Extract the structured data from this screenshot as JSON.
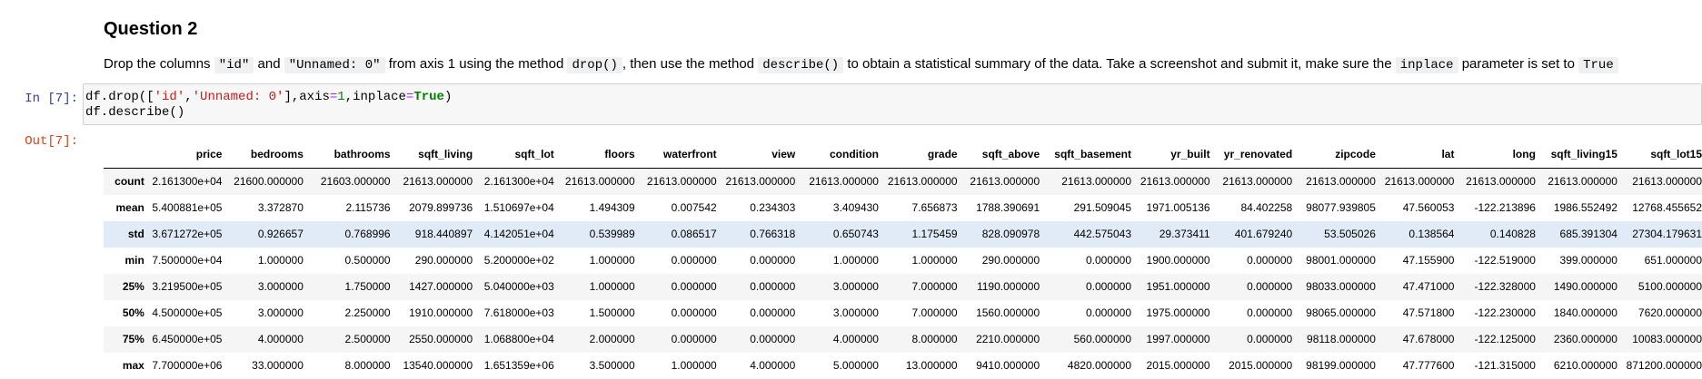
{
  "markdown": {
    "heading": "Question 2",
    "text_1": "Drop the columns ",
    "code_1": "\"id\"",
    "text_2": " and ",
    "code_2": "\"Unnamed: 0\"",
    "text_3": " from axis 1 using the method ",
    "code_3": "drop()",
    "text_4": ", then use the method ",
    "code_4": "describe()",
    "text_5": " to obtain a statistical summary of the data. Take a screenshot and submit it, make sure the ",
    "code_5": "inplace",
    "text_6": " parameter is set to ",
    "code_6": "True"
  },
  "cell": {
    "in_prompt": "In [7]:",
    "out_prompt": "Out[7]:",
    "code": {
      "l1_a": "df.drop([",
      "l1_s1": "'id'",
      "l1_b": ",",
      "l1_s2": "'Unnamed: 0'",
      "l1_c": "],axis",
      "l1_eq1": "=",
      "l1_n": "1",
      "l1_d": ",inplace",
      "l1_eq2": "=",
      "l1_kw": "True",
      "l1_e": ")",
      "l2": "df.describe()"
    }
  },
  "table": {
    "columns": [
      "price",
      "bedrooms",
      "bathrooms",
      "sqft_living",
      "sqft_lot",
      "floors",
      "waterfront",
      "view",
      "condition",
      "grade",
      "sqft_above",
      "sqft_basement",
      "yr_built",
      "yr_renovated",
      "zipcode",
      "lat",
      "long",
      "sqft_living15",
      "sqft_lot15"
    ],
    "rows": [
      {
        "label": "count",
        "values": [
          "2.161300e+04",
          "21600.000000",
          "21603.000000",
          "21613.000000",
          "2.161300e+04",
          "21613.000000",
          "21613.000000",
          "21613.000000",
          "21613.000000",
          "21613.000000",
          "21613.000000",
          "21613.000000",
          "21613.000000",
          "21613.000000",
          "21613.000000",
          "21613.000000",
          "21613.000000",
          "21613.000000",
          "21613.000000"
        ]
      },
      {
        "label": "mean",
        "values": [
          "5.400881e+05",
          "3.372870",
          "2.115736",
          "2079.899736",
          "1.510697e+04",
          "1.494309",
          "0.007542",
          "0.234303",
          "3.409430",
          "7.656873",
          "1788.390691",
          "291.509045",
          "1971.005136",
          "84.402258",
          "98077.939805",
          "47.560053",
          "-122.213896",
          "1986.552492",
          "12768.455652"
        ]
      },
      {
        "label": "std",
        "values": [
          "3.671272e+05",
          "0.926657",
          "0.768996",
          "918.440897",
          "4.142051e+04",
          "0.539989",
          "0.086517",
          "0.766318",
          "0.650743",
          "1.175459",
          "828.090978",
          "442.575043",
          "29.373411",
          "401.679240",
          "53.505026",
          "0.138564",
          "0.140828",
          "685.391304",
          "27304.179631"
        ]
      },
      {
        "label": "min",
        "values": [
          "7.500000e+04",
          "1.000000",
          "0.500000",
          "290.000000",
          "5.200000e+02",
          "1.000000",
          "0.000000",
          "0.000000",
          "1.000000",
          "1.000000",
          "290.000000",
          "0.000000",
          "1900.000000",
          "0.000000",
          "98001.000000",
          "47.155900",
          "-122.519000",
          "399.000000",
          "651.000000"
        ]
      },
      {
        "label": "25%",
        "values": [
          "3.219500e+05",
          "3.000000",
          "1.750000",
          "1427.000000",
          "5.040000e+03",
          "1.000000",
          "0.000000",
          "0.000000",
          "3.000000",
          "7.000000",
          "1190.000000",
          "0.000000",
          "1951.000000",
          "0.000000",
          "98033.000000",
          "47.471000",
          "-122.328000",
          "1490.000000",
          "5100.000000"
        ]
      },
      {
        "label": "50%",
        "values": [
          "4.500000e+05",
          "3.000000",
          "2.250000",
          "1910.000000",
          "7.618000e+03",
          "1.500000",
          "0.000000",
          "0.000000",
          "3.000000",
          "7.000000",
          "1560.000000",
          "0.000000",
          "1975.000000",
          "0.000000",
          "98065.000000",
          "47.571800",
          "-122.230000",
          "1840.000000",
          "7620.000000"
        ]
      },
      {
        "label": "75%",
        "values": [
          "6.450000e+05",
          "4.000000",
          "2.500000",
          "2550.000000",
          "1.068800e+04",
          "2.000000",
          "0.000000",
          "0.000000",
          "4.000000",
          "8.000000",
          "2210.000000",
          "560.000000",
          "1997.000000",
          "0.000000",
          "98118.000000",
          "47.678000",
          "-122.125000",
          "2360.000000",
          "10083.000000"
        ]
      },
      {
        "label": "max",
        "values": [
          "7.700000e+06",
          "33.000000",
          "8.000000",
          "13540.000000",
          "1.651359e+06",
          "3.500000",
          "1.000000",
          "4.000000",
          "5.000000",
          "13.000000",
          "9410.000000",
          "4820.000000",
          "2015.000000",
          "2015.000000",
          "98199.000000",
          "47.777600",
          "-121.315000",
          "6210.000000",
          "871200.000000"
        ]
      }
    ]
  }
}
